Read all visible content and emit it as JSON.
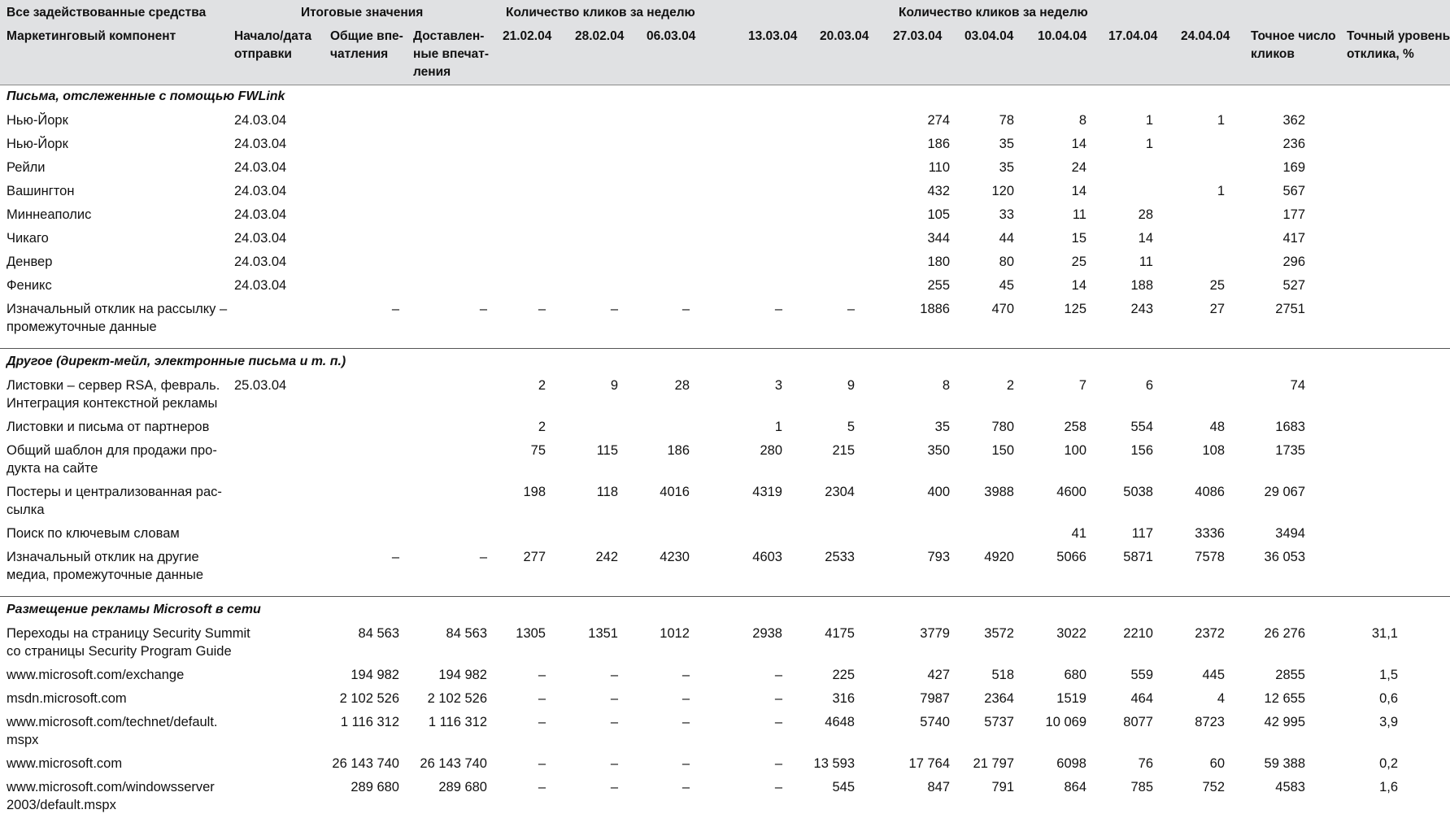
{
  "header": {
    "group_all": "Все задействованные средства",
    "group_totals": "Итоговые значения",
    "group_clicks1": "Количество кликов за неделю",
    "group_clicks2": "Количество кликов за неделю",
    "col_component": "Маркетинговый компонент",
    "col_start": [
      "Начало/дата",
      "отправки"
    ],
    "col_total_impr": [
      "Общие впе-",
      "чатления"
    ],
    "col_delivered": [
      "Доставлен-",
      "ные впечат-",
      "ления"
    ],
    "weeks": [
      "21.02.04",
      "28.02.04",
      "06.03.04",
      "13.03.04",
      "20.03.04",
      "27.03.04",
      "03.04.04",
      "10.04.04",
      "17.04.04",
      "24.04.04"
    ],
    "col_exact_clicks": [
      "Точное число",
      "кликов"
    ],
    "col_response": [
      "Точный уровень",
      "отклика, %"
    ]
  },
  "sections": [
    {
      "title": "Письма, отслеженные с помощью FWLink",
      "rows": [
        {
          "label": [
            "Нью-Йорк"
          ],
          "start": "24.03.04",
          "total": "",
          "delivered": "",
          "w": [
            "",
            "",
            "",
            "",
            "",
            "274",
            "78",
            "8",
            "1",
            "1"
          ],
          "exact": "362",
          "resp": ""
        },
        {
          "label": [
            "Нью-Йорк"
          ],
          "start": "24.03.04",
          "total": "",
          "delivered": "",
          "w": [
            "",
            "",
            "",
            "",
            "",
            "186",
            "35",
            "14",
            "1",
            ""
          ],
          "exact": "236",
          "resp": ""
        },
        {
          "label": [
            "Рейли"
          ],
          "start": "24.03.04",
          "total": "",
          "delivered": "",
          "w": [
            "",
            "",
            "",
            "",
            "",
            "110",
            "35",
            "24",
            "",
            ""
          ],
          "exact": "169",
          "resp": ""
        },
        {
          "label": [
            "Вашингтон"
          ],
          "start": "24.03.04",
          "total": "",
          "delivered": "",
          "w": [
            "",
            "",
            "",
            "",
            "",
            "432",
            "120",
            "14",
            "",
            "1"
          ],
          "exact": "567",
          "resp": ""
        },
        {
          "label": [
            "Миннеаполис"
          ],
          "start": "24.03.04",
          "total": "",
          "delivered": "",
          "w": [
            "",
            "",
            "",
            "",
            "",
            "105",
            "33",
            "11",
            "28",
            ""
          ],
          "exact": "177",
          "resp": ""
        },
        {
          "label": [
            "Чикаго"
          ],
          "start": "24.03.04",
          "total": "",
          "delivered": "",
          "w": [
            "",
            "",
            "",
            "",
            "",
            "344",
            "44",
            "15",
            "14",
            ""
          ],
          "exact": "417",
          "resp": ""
        },
        {
          "label": [
            "Денвер"
          ],
          "start": "24.03.04",
          "total": "",
          "delivered": "",
          "w": [
            "",
            "",
            "",
            "",
            "",
            "180",
            "80",
            "25",
            "11",
            ""
          ],
          "exact": "296",
          "resp": ""
        },
        {
          "label": [
            "Феникс"
          ],
          "start": "24.03.04",
          "total": "",
          "delivered": "",
          "w": [
            "",
            "",
            "",
            "",
            "",
            "255",
            "45",
            "14",
            "188",
            "25"
          ],
          "exact": "527",
          "resp": ""
        },
        {
          "label": [
            "Изначальный отклик на рассылку –",
            "промежуточные данные"
          ],
          "start": "",
          "total": "–",
          "delivered": "–",
          "w": [
            "–",
            "–",
            "–",
            "–",
            "–",
            "1886",
            "470",
            "125",
            "243",
            "27"
          ],
          "exact": "2751",
          "resp": ""
        }
      ]
    },
    {
      "title": "Другое (директ-мейл, электронные письма и т. п.)",
      "rows": [
        {
          "label": [
            "Листовки – сервер RSA, февраль.",
            "Интеграция контекстной рекламы"
          ],
          "start": "25.03.04",
          "total": "",
          "delivered": "",
          "w": [
            "2",
            "9",
            "28",
            "3",
            "9",
            "8",
            "2",
            "7",
            "6",
            ""
          ],
          "exact": "74",
          "resp": ""
        },
        {
          "label": [
            "Листовки и письма от партнеров"
          ],
          "start": "",
          "total": "",
          "delivered": "",
          "w": [
            "2",
            "",
            "",
            "1",
            "5",
            "35",
            "780",
            "258",
            "554",
            "48"
          ],
          "exact": "1683",
          "resp": ""
        },
        {
          "label": [
            "Общий шаблон для продажи про-",
            "дукта на сайте"
          ],
          "start": "",
          "total": "",
          "delivered": "",
          "w": [
            "75",
            "115",
            "186",
            "280",
            "215",
            "350",
            "150",
            "100",
            "156",
            "108"
          ],
          "exact": "1735",
          "resp": ""
        },
        {
          "label": [
            "Постеры и централизованная рас-",
            "сылка"
          ],
          "start": "",
          "total": "",
          "delivered": "",
          "w": [
            "198",
            "118",
            "4016",
            "4319",
            "2304",
            "400",
            "3988",
            "4600",
            "5038",
            "4086"
          ],
          "exact": "29 067",
          "resp": ""
        },
        {
          "label": [
            "Поиск по ключевым словам"
          ],
          "start": "",
          "total": "",
          "delivered": "",
          "w": [
            "",
            "",
            "",
            "",
            "",
            "",
            "",
            "41",
            "117",
            "3336"
          ],
          "exact": "3494",
          "resp": ""
        },
        {
          "label": [
            "Изначальный отклик на другие",
            "медиа, промежуточные данные"
          ],
          "start": "",
          "total": "–",
          "delivered": "–",
          "w": [
            "277",
            "242",
            "4230",
            "4603",
            "2533",
            "793",
            "4920",
            "5066",
            "5871",
            "7578"
          ],
          "exact": "36 053",
          "resp": ""
        }
      ]
    },
    {
      "title": "Размещение рекламы Microsoft в сети",
      "rows": [
        {
          "label": [
            "Переходы на страницу Security Summit",
            "со страницы Security Program Guide"
          ],
          "start": "",
          "total": "84 563",
          "delivered": "84 563",
          "w": [
            "1305",
            "1351",
            "1012",
            "2938",
            "4175",
            "3779",
            "3572",
            "3022",
            "2210",
            "2372"
          ],
          "exact": "26 276",
          "resp": "31,1"
        },
        {
          "label": [
            "www.microsoft.com/exchange"
          ],
          "start": "",
          "total": "194 982",
          "delivered": "194 982",
          "w": [
            "–",
            "–",
            "–",
            "–",
            "225",
            "427",
            "518",
            "680",
            "559",
            "445"
          ],
          "exact": "2855",
          "resp": "1,5"
        },
        {
          "label": [
            "msdn.microsoft.com"
          ],
          "start": "",
          "total": "2 102 526",
          "delivered": "2 102 526",
          "w": [
            "–",
            "–",
            "–",
            "–",
            "316",
            "7987",
            "2364",
            "1519",
            "464",
            "4"
          ],
          "exact": "12 655",
          "resp": "0,6"
        },
        {
          "label": [
            "www.microsoft.com/technet/default.",
            "mspx"
          ],
          "start": "",
          "total": "1 116 312",
          "delivered": "1 116 312",
          "w": [
            "–",
            "–",
            "–",
            "–",
            "4648",
            "5740",
            "5737",
            "10 069",
            "8077",
            "8723"
          ],
          "exact": "42 995",
          "resp": "3,9"
        },
        {
          "label": [
            "www.microsoft.com"
          ],
          "start": "",
          "total": "26 143 740",
          "delivered": "26 143 740",
          "w": [
            "–",
            "–",
            "–",
            "–",
            "13 593",
            "17 764",
            "21 797",
            "6098",
            "76",
            "60"
          ],
          "exact": "59 388",
          "resp": "0,2"
        },
        {
          "label": [
            "www.microsoft.com/windowsserver",
            "2003/default.mspx"
          ],
          "start": "",
          "total": "289 680",
          "delivered": "289 680",
          "w": [
            "–",
            "–",
            "–",
            "–",
            "545",
            "847",
            "791",
            "864",
            "785",
            "752"
          ],
          "exact": "4583",
          "resp": "1,6"
        }
      ]
    }
  ]
}
